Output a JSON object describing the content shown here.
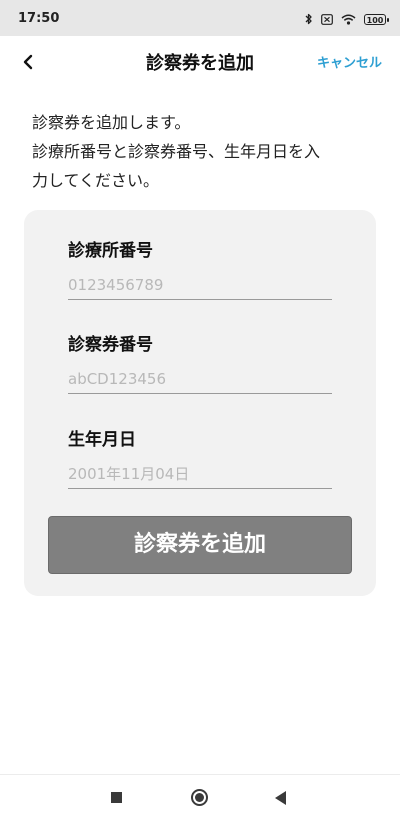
{
  "status_bar": {
    "time": "17:50",
    "icons": [
      "bluetooth-icon",
      "sim-off-icon",
      "wifi-icon",
      "battery-icon"
    ],
    "battery_level": "100"
  },
  "header": {
    "title": "診察券を追加",
    "cancel_label": "キャンセル",
    "back_icon": "chevron-left-icon"
  },
  "instructions": {
    "line1": "診察券を追加します。",
    "line2": "診療所番号と診察券番号、生年月日を入",
    "line3": "力してください。"
  },
  "form": {
    "clinic_number": {
      "label": "診療所番号",
      "value": "",
      "placeholder": "0123456789"
    },
    "card_number": {
      "label": "診察券番号",
      "value": "",
      "placeholder": "abCD123456"
    },
    "birth_date": {
      "label": "生年月日",
      "value": "",
      "placeholder": "2001年11月04日"
    },
    "submit_label": "診察券を追加"
  },
  "nav_bar": {
    "icons": [
      "recent-apps-icon",
      "home-icon",
      "back-icon"
    ]
  },
  "colors": {
    "accent": "#2e9fd2",
    "button_disabled": "#808080",
    "card_background": "#f2f2f2",
    "status_bar_background": "#e7e7e7"
  }
}
